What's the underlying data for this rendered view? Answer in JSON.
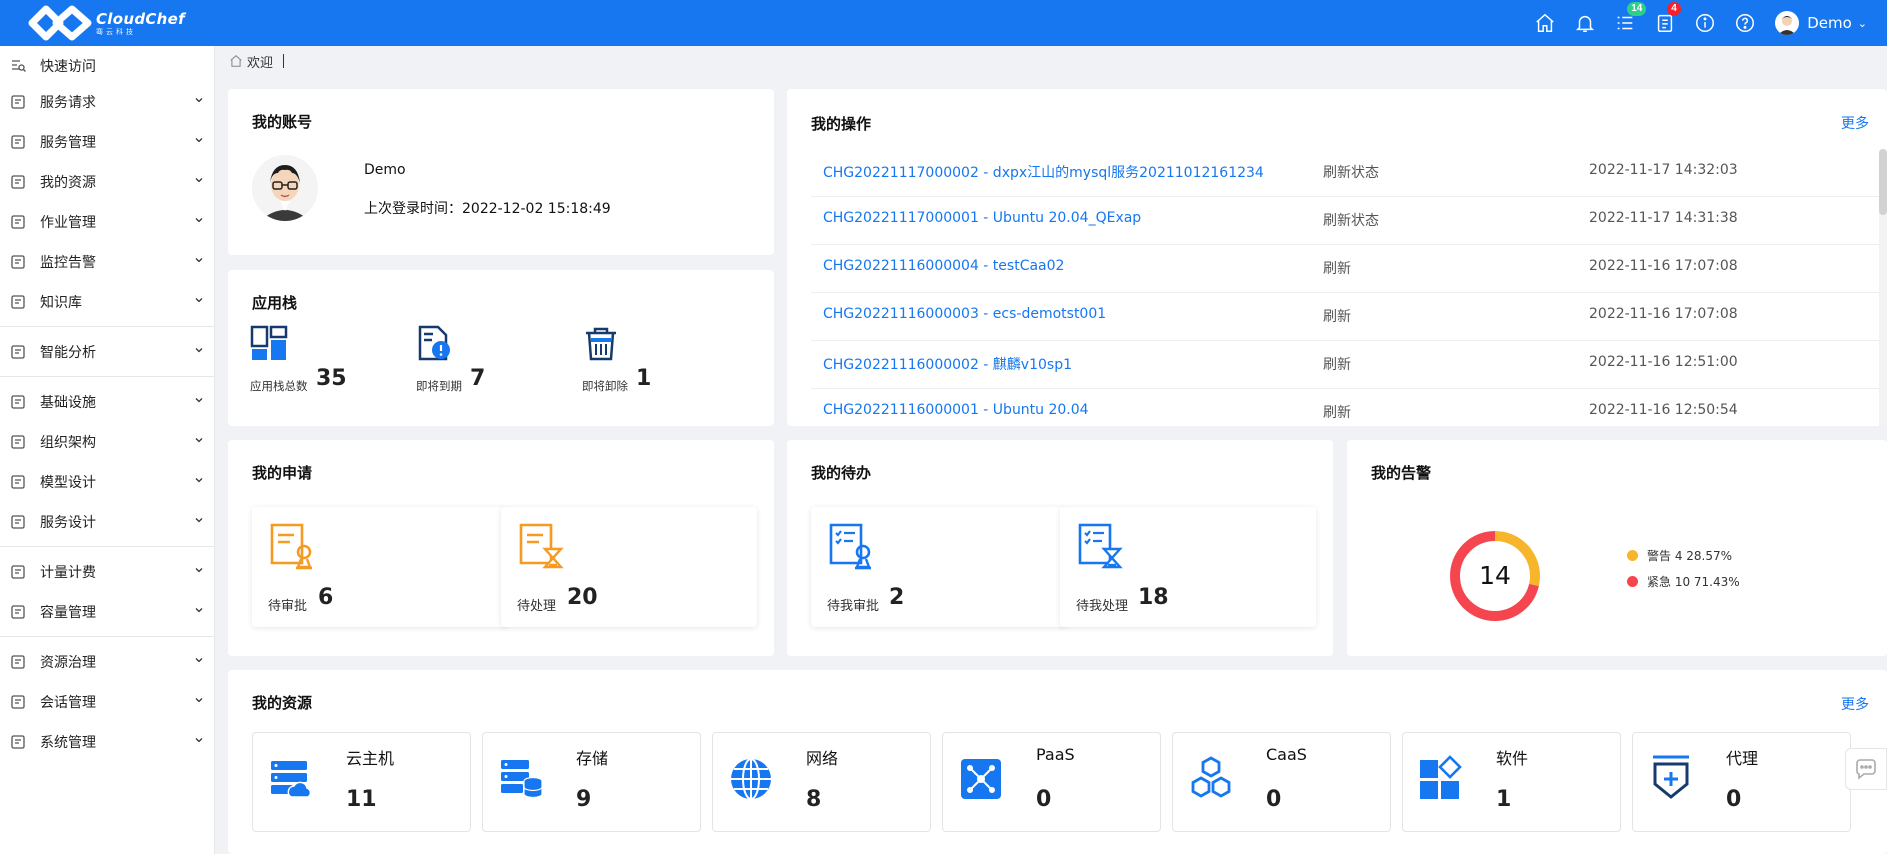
{
  "app": {
    "logo_text": "CloudChef",
    "logo_sub": "骞云科技"
  },
  "topbar": {
    "badges": {
      "tasks": "14",
      "orders": "4"
    },
    "user_name": "Demo"
  },
  "sidebar": {
    "items": [
      {
        "label": "快速访问",
        "icon": "quick-access-icon",
        "expandable": false
      },
      {
        "label": "服务请求",
        "icon": "service-request-icon",
        "expandable": true
      },
      {
        "label": "服务管理",
        "icon": "service-manage-icon",
        "expandable": true
      },
      {
        "label": "我的资源",
        "icon": "my-resource-icon",
        "expandable": true
      },
      {
        "label": "作业管理",
        "icon": "job-manage-icon",
        "expandable": true
      },
      {
        "label": "监控告警",
        "icon": "monitor-alert-icon",
        "expandable": true
      },
      {
        "label": "知识库",
        "icon": "knowledge-base-icon",
        "expandable": true
      },
      {
        "label": "智能分析",
        "icon": "analysis-icon",
        "expandable": true
      },
      {
        "label": "基础设施",
        "icon": "infrastructure-icon",
        "expandable": true
      },
      {
        "label": "组织架构",
        "icon": "organization-icon",
        "expandable": true
      },
      {
        "label": "模型设计",
        "icon": "model-design-icon",
        "expandable": true
      },
      {
        "label": "服务设计",
        "icon": "service-design-icon",
        "expandable": true
      },
      {
        "label": "计量计费",
        "icon": "billing-icon",
        "expandable": true
      },
      {
        "label": "容量管理",
        "icon": "capacity-icon",
        "expandable": true
      },
      {
        "label": "资源治理",
        "icon": "governance-icon",
        "expandable": true
      },
      {
        "label": "会话管理",
        "icon": "session-icon",
        "expandable": true
      },
      {
        "label": "系统管理",
        "icon": "system-icon",
        "expandable": true
      }
    ]
  },
  "breadcrumb": {
    "label": "欢迎"
  },
  "account": {
    "title": "我的账号",
    "name": "Demo",
    "last_login": "上次登录时间：2022-12-02 15:18:49"
  },
  "app_stack": {
    "title": "应用栈",
    "stats": [
      {
        "label": "应用栈总数",
        "value": "35",
        "icon": "stack-total-icon"
      },
      {
        "label": "即将到期",
        "value": "7",
        "icon": "expiring-icon"
      },
      {
        "label": "即将卸除",
        "value": "1",
        "icon": "trash-icon"
      }
    ]
  },
  "operations": {
    "title": "我的操作",
    "more": "更多",
    "rows": [
      {
        "name": "CHG20221117000002 - dxpx江山的mysql服务20211012161234",
        "action": "刷新状态",
        "time": "2022-11-17 14:32:03"
      },
      {
        "name": "CHG20221117000001 - Ubuntu 20.04_QExap",
        "action": "刷新状态",
        "time": "2022-11-17 14:31:38"
      },
      {
        "name": "CHG20221116000004 - testCaa02",
        "action": "刷新",
        "time": "2022-11-16 17:07:08"
      },
      {
        "name": "CHG20221116000003 - ecs-demotst001",
        "action": "刷新",
        "time": "2022-11-16 17:07:08"
      },
      {
        "name": "CHG20221116000002 - 麒麟v10sp1",
        "action": "刷新",
        "time": "2022-11-16 12:51:00"
      },
      {
        "name": "CHG20221116000001 - Ubuntu 20.04",
        "action": "刷新",
        "time": "2022-11-16 12:50:54"
      }
    ]
  },
  "requests": {
    "title": "我的申请",
    "tiles": [
      {
        "label": "待审批",
        "value": "6"
      },
      {
        "label": "待处理",
        "value": "20"
      }
    ]
  },
  "todos": {
    "title": "我的待办",
    "tiles": [
      {
        "label": "待我审批",
        "value": "2"
      },
      {
        "label": "待我处理",
        "value": "18"
      }
    ]
  },
  "alerts": {
    "title": "我的告警",
    "total": "14",
    "legend": [
      {
        "label": "警告 4 28.57%",
        "color": "#f7b52c",
        "value": 4
      },
      {
        "label": "紧急 10 71.43%",
        "color": "#f5454f",
        "value": 10
      }
    ]
  },
  "resources": {
    "title": "我的资源",
    "more": "更多",
    "items": [
      {
        "label": "云主机",
        "value": "11",
        "icon": "cloud-host-icon"
      },
      {
        "label": "存储",
        "value": "9",
        "icon": "storage-icon"
      },
      {
        "label": "网络",
        "value": "8",
        "icon": "network-icon"
      },
      {
        "label": "PaaS",
        "value": "0",
        "icon": "paas-icon"
      },
      {
        "label": "CaaS",
        "value": "0",
        "icon": "caas-icon"
      },
      {
        "label": "软件",
        "value": "1",
        "icon": "software-icon"
      },
      {
        "label": "代理",
        "value": "0",
        "icon": "agent-icon"
      }
    ]
  },
  "colors": {
    "brand": "#1677f0",
    "orange": "#f59a23",
    "blue": "#1677f0"
  }
}
